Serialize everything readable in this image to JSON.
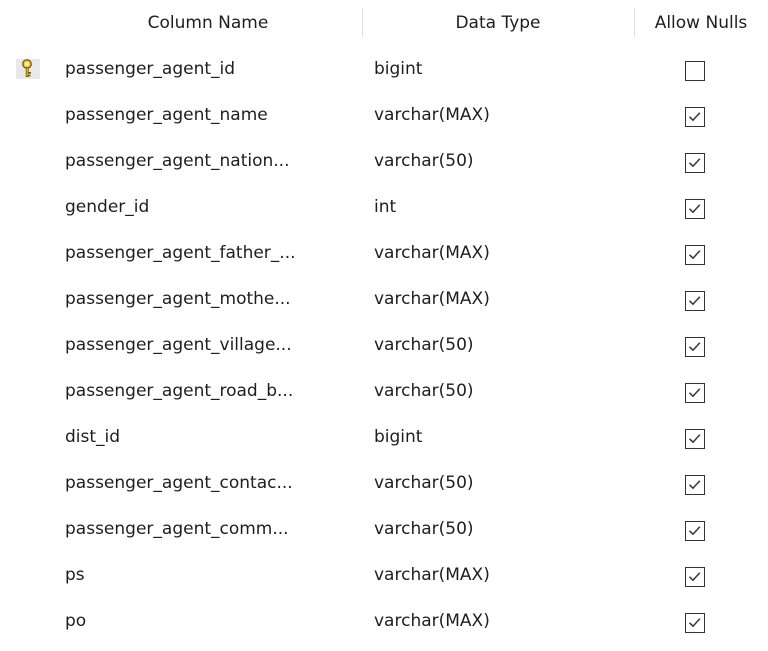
{
  "columns": {
    "name_header": "Column Name",
    "type_header": "Data Type",
    "nulls_header": "Allow Nulls"
  },
  "rows": [
    {
      "name": "passenger_agent_id",
      "type": "bigint",
      "allow_nulls": false,
      "primary_key": true
    },
    {
      "name": "passenger_agent_name",
      "type": "varchar(MAX)",
      "allow_nulls": true,
      "primary_key": false
    },
    {
      "name": "passenger_agent_nation...",
      "type": "varchar(50)",
      "allow_nulls": true,
      "primary_key": false
    },
    {
      "name": "gender_id",
      "type": "int",
      "allow_nulls": true,
      "primary_key": false
    },
    {
      "name": "passenger_agent_father_...",
      "type": "varchar(MAX)",
      "allow_nulls": true,
      "primary_key": false
    },
    {
      "name": "passenger_agent_mothe...",
      "type": "varchar(MAX)",
      "allow_nulls": true,
      "primary_key": false
    },
    {
      "name": "passenger_agent_village...",
      "type": "varchar(50)",
      "allow_nulls": true,
      "primary_key": false
    },
    {
      "name": "passenger_agent_road_b...",
      "type": "varchar(50)",
      "allow_nulls": true,
      "primary_key": false
    },
    {
      "name": "dist_id",
      "type": "bigint",
      "allow_nulls": true,
      "primary_key": false
    },
    {
      "name": "passenger_agent_contac...",
      "type": "varchar(50)",
      "allow_nulls": true,
      "primary_key": false
    },
    {
      "name": "passenger_agent_comm...",
      "type": "varchar(50)",
      "allow_nulls": true,
      "primary_key": false
    },
    {
      "name": "ps",
      "type": "varchar(MAX)",
      "allow_nulls": true,
      "primary_key": false
    },
    {
      "name": "po",
      "type": "varchar(MAX)",
      "allow_nulls": true,
      "primary_key": false
    }
  ],
  "icons": {
    "primary_key": "key-icon",
    "checked": "check-icon"
  },
  "colors": {
    "key_fill": "#f5d547",
    "key_stroke": "#7a6000",
    "checkbox_border": "#333333"
  }
}
